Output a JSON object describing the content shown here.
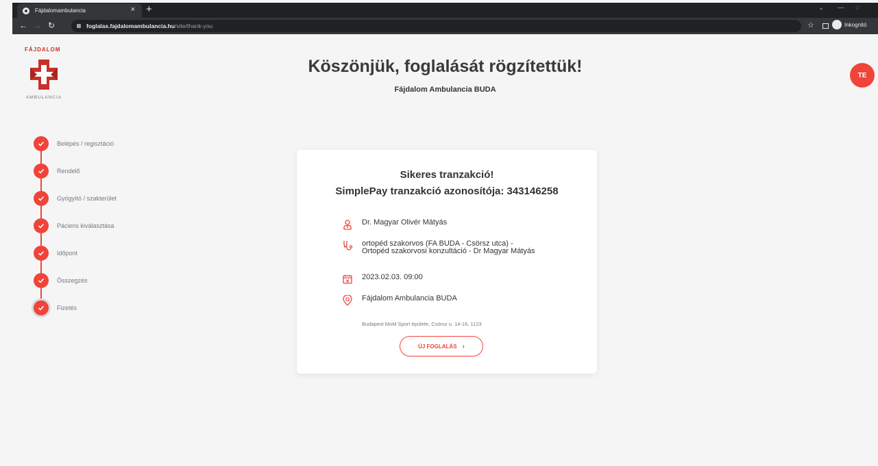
{
  "browser": {
    "tab_title": "Fájdalomambulancia",
    "tab_close": "×",
    "new_tab": "+",
    "url_host": "foglalas.fajdalomambulancia.hu",
    "url_path": "/site/thank-you",
    "incognito_label": "Inkognitó"
  },
  "logo": {
    "top_text": "FÁJDALOM",
    "bottom_text": "AMBULANCIA",
    "brand_color": "#c8302a"
  },
  "header": {
    "title": "Köszönjük, foglalását rögzítettük!",
    "subtitle": "Fájdalom Ambulancia BUDA",
    "avatar_initials": "TE"
  },
  "steps": [
    {
      "label": "Belépés / regisztáció"
    },
    {
      "label": "Rendelő"
    },
    {
      "label": "Gyógyító / szakterület"
    },
    {
      "label": "Páciens kiválasztása"
    },
    {
      "label": "Időpont"
    },
    {
      "label": "Összegzés"
    },
    {
      "label": "Fizetés"
    }
  ],
  "card": {
    "title": "Sikeres tranzakció!",
    "transaction_line": "SimplePay tranzakció azonosítója: 343146258",
    "doctor": "Dr. Magyar Olivér Mátyás",
    "service": "ortopéd szakorvos (FA BUDA - Csörsz utca) - Ortopéd szakorvosi konzultáció - Dr Magyar Mátyás",
    "datetime": "2023.02.03. 09:00",
    "location": "Fájdalom Ambulancia BUDA",
    "address": "Budapest MoM Sport épülete, Csörsz u. 14-16, 1123",
    "button_label": "ÚJ FOGLALÁS",
    "button_chevron": "›"
  },
  "colors": {
    "accent": "#f0443a",
    "text": "#333333",
    "muted": "#777777",
    "background": "#f5f5f5"
  }
}
